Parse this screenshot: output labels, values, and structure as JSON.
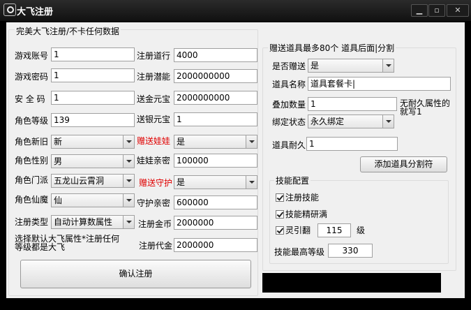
{
  "window": {
    "title": "大飞注册"
  },
  "left": {
    "group_title": "完美大飞注册/不卡任何数据",
    "rows": [
      {
        "label": "游戏账号",
        "value": "1"
      },
      {
        "label": "游戏密码",
        "value": "1"
      },
      {
        "label": "安 全 码",
        "value": "1"
      },
      {
        "label": "角色等级",
        "value": "139"
      }
    ],
    "selects": [
      {
        "label": "角色新旧",
        "value": "新"
      },
      {
        "label": "角色性别",
        "value": "男"
      },
      {
        "label": "角色门派",
        "value": "五龙山云霄洞"
      },
      {
        "label": "角色仙魔",
        "value": "仙"
      },
      {
        "label": "注册类型",
        "value": "自动计算数属性"
      }
    ],
    "right_fields": [
      {
        "label": "注册道行",
        "value": "4000"
      },
      {
        "label": "注册潜能",
        "value": "2000000000"
      },
      {
        "label": "送金元宝",
        "value": "2000000000"
      },
      {
        "label": "送银元宝",
        "value": "1"
      }
    ],
    "gift_doll": {
      "label": "赠送娃娃",
      "value": "是"
    },
    "doll_intimacy": {
      "label": "娃娃亲密",
      "value": "100000"
    },
    "gift_guard": {
      "label": "赠送守护",
      "value": "是"
    },
    "guard_intimacy": {
      "label": "守护亲密",
      "value": "600000"
    },
    "reg_gold": {
      "label": "注册金币",
      "value": "2000000"
    },
    "reg_voucher": {
      "label": "注册代金",
      "value": "2000000"
    },
    "note": "选择默认大飞属性*注册任何等级都是大飞",
    "confirm_label": "确认注册"
  },
  "right": {
    "group_title": "赠送道具最多80个 道具后面|分割",
    "gift": {
      "label": "是否赠送",
      "value": "是"
    },
    "item_name": {
      "label": "道具名称",
      "value": "道具套餐卡|"
    },
    "stack": {
      "label": "叠加数量",
      "value": "1"
    },
    "stack_note": "无耐久属性的就写1",
    "bind": {
      "label": "绑定状态",
      "value": "永久绑定"
    },
    "durability": {
      "label": "道具耐久",
      "value": "1"
    },
    "add_sep_label": "添加道具分割符",
    "skills": {
      "title": "技能配置",
      "reg_skill": "注册技能",
      "skill_master": "技能精研满",
      "lingyin": "灵引翻",
      "lingyin_value": "115",
      "lingyin_unit": "级",
      "max_level_label": "技能最高等级",
      "max_level_value": "330"
    }
  }
}
